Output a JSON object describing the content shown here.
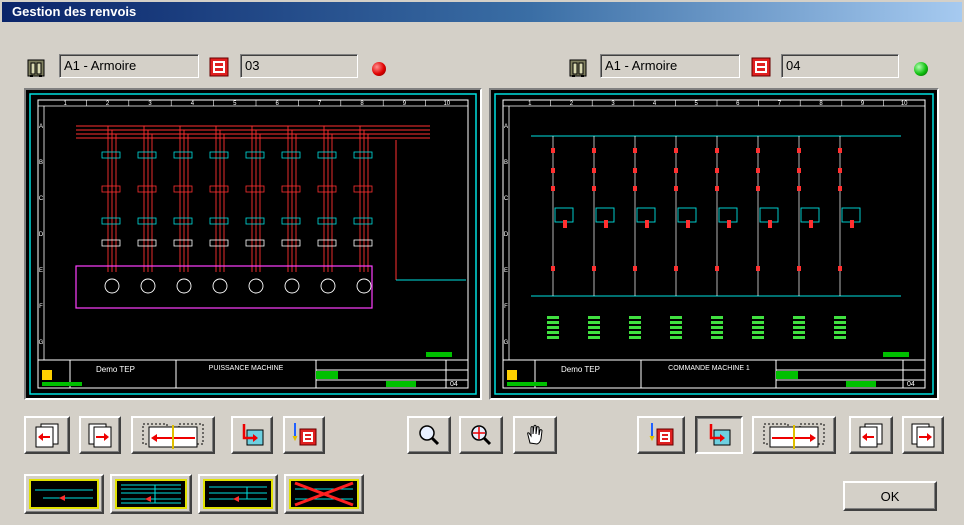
{
  "window": {
    "title": "Gestion des renvois"
  },
  "left": {
    "cabinet": "A1 - Armoire",
    "folio": "03",
    "status_color": "#e00000"
  },
  "right": {
    "cabinet": "A1 - Armoire",
    "folio": "04",
    "status_color": "#00c000"
  },
  "previews": {
    "left": {
      "title_block": {
        "client": "Demo TEP",
        "title": "PUISSANCE MACHINE",
        "page": "04"
      },
      "columns": [
        "1",
        "2",
        "3",
        "4",
        "5",
        "6",
        "7",
        "8",
        "9",
        "10"
      ],
      "rows": [
        "A",
        "B",
        "C",
        "D",
        "E",
        "F",
        "G"
      ]
    },
    "right": {
      "title_block": {
        "client": "Demo TEP",
        "title": "COMMANDE MACHINE 1",
        "page": "04"
      },
      "columns": [
        "1",
        "2",
        "3",
        "4",
        "5",
        "6",
        "7",
        "8",
        "9",
        "10"
      ],
      "rows": [
        "A",
        "B",
        "C",
        "D",
        "E",
        "F",
        "G"
      ]
    }
  },
  "toolbar": {
    "left_buttons": [
      "previous-folio",
      "next-folio",
      "compare-folios",
      "link-reference",
      "cross-reference"
    ],
    "center_buttons": [
      "zoom",
      "zoom-target",
      "pan-hand"
    ],
    "right_buttons": [
      "cross-reference",
      "link-reference",
      "compare-folios",
      "previous-folio",
      "next-folio"
    ],
    "bottom_buttons": [
      "single-link",
      "multi-link",
      "link-ends",
      "delete-links"
    ]
  },
  "ok_label": "OK",
  "colors": {
    "title_bar": "#0a246a",
    "drawing_bg": "#000000",
    "drawing_frame": "#00ffff",
    "wire_red": "#ff2020",
    "wire_cyan": "#00e0e0"
  }
}
